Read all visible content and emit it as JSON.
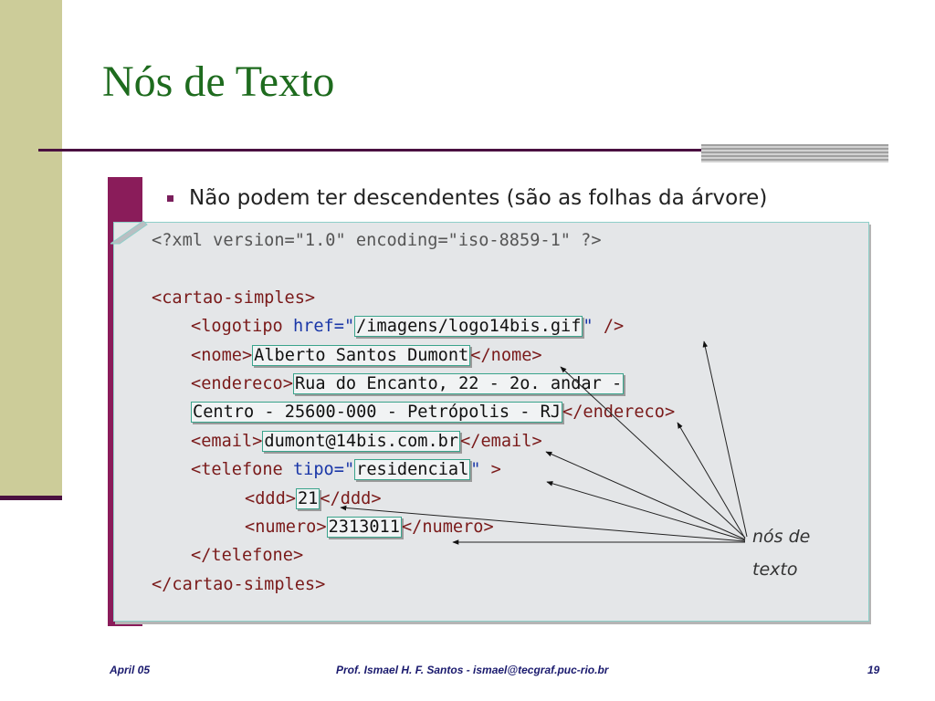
{
  "slide": {
    "title": "Nós de Texto",
    "bullet": "Não podem ter descendentes (são as folhas da árvore)"
  },
  "code": {
    "xml_decl": "<?xml version=\"1.0\" encoding=\"iso-8859-1\" ?>",
    "cartao_open": "<cartao-simples>",
    "logotipo_open": "<logotipo",
    "href_attr": "href=",
    "quote_open": "\"",
    "logotipo_value": "/imagens/logo14bis.gif",
    "quote_close": "\"",
    "logotipo_close": " />",
    "nome_open": "<nome>",
    "nome_value": "Alberto Santos Dumont",
    "nome_close": "</nome>",
    "endereco_open": "<endereco>",
    "endereco_value_1": "Rua do Encanto, 22 - 2o. andar -",
    "endereco_value_2": "Centro - 25600-000 - Petrópolis - RJ",
    "endereco_close": "</endereco>",
    "email_open": "<email>",
    "email_value": "dumont@14bis.com.br",
    "email_close": "</email>",
    "telefone_open": "<telefone",
    "tipo_attr": "tipo=",
    "telefone_value": "residencial",
    "telefone_tail": " >",
    "ddd_open": "<ddd>",
    "ddd_value": "21",
    "ddd_close": "</ddd>",
    "numero_open": "<numero>",
    "numero_value": "2313011",
    "numero_close": "</numero>",
    "telefone_close": "</telefone>",
    "cartao_close": "</cartao-simples>"
  },
  "annotation": {
    "line1": "nós de",
    "line2": "texto"
  },
  "footer": {
    "date": "April 05",
    "author": "Prof. Ismael H. F. Santos -  ismael@tecgraf.puc-rio.br",
    "page": "19"
  },
  "colors": {
    "title_green": "#1e6b1e",
    "accent_purple": "#4a1040",
    "side_bar": "#cccc99",
    "tag_brown": "#7a1a1a",
    "attr_blue": "#1a37a8",
    "highlight_border": "#3aa48c",
    "footer_navy": "#1a1a6e"
  }
}
